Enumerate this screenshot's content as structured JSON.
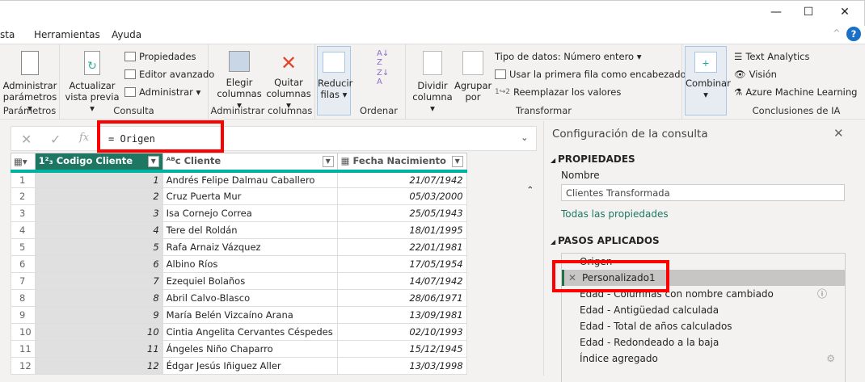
{
  "window": {
    "minimize": "—",
    "maximize": "☐",
    "close": "✕"
  },
  "menu_tabs": [
    "sta",
    "Herramientas",
    "Ayuda"
  ],
  "ribbon": {
    "groups": {
      "parametros": "Parámetros",
      "consulta": "Consulta",
      "admin_cols": "Administrar columnas",
      "ordenar": "Ordenar",
      "transformar": "Transformar",
      "ia": "Conclusiones de IA"
    },
    "admin_params": [
      "Administrar",
      "parámetros ▾"
    ],
    "actualizar": [
      "Actualizar",
      "vista previa ▾"
    ],
    "propiedades": "Propiedades",
    "editor": "Editor avanzado",
    "administrar": "Administrar ▾",
    "elegir": [
      "Elegir",
      "columnas ▾"
    ],
    "quitar": [
      "Quitar",
      "columnas ▾"
    ],
    "reducir": [
      "Reducir",
      "filas ▾"
    ],
    "dividir": [
      "Dividir",
      "columna ▾"
    ],
    "agrupar": [
      "Agrupar",
      "por"
    ],
    "tipo": "Tipo de datos: Número entero ▾",
    "primera_fila": "Usar la primera fila como encabezado ▾",
    "reemplazar": "Reemplazar los valores",
    "combinar": [
      "Combinar",
      "▾"
    ],
    "text_analytics": "Text Analytics",
    "vision": "Visión",
    "azure": "Azure Machine Learning"
  },
  "formula": {
    "text": "= Origen"
  },
  "table": {
    "columns": [
      "Codigo Cliente",
      "Cliente",
      "Fecha Nacimiento"
    ],
    "type_icons": [
      "1²₃",
      "ᴬᴮc",
      "▦"
    ],
    "rows": [
      [
        "1",
        "1",
        "Andrés Felipe Dalmau Caballero",
        "21/07/1942"
      ],
      [
        "2",
        "2",
        "Cruz Puerta Mur",
        "05/03/2000"
      ],
      [
        "3",
        "3",
        "Isa Cornejo Correa",
        "25/05/1943"
      ],
      [
        "4",
        "4",
        "Tere del Roldán",
        "18/01/1995"
      ],
      [
        "5",
        "5",
        "Rafa Arnaiz Vázquez",
        "22/01/1981"
      ],
      [
        "6",
        "6",
        "Albino Ríos",
        "17/05/1954"
      ],
      [
        "7",
        "7",
        "Ezequiel Bolaños",
        "14/07/1942"
      ],
      [
        "8",
        "8",
        "Abril Calvo-Blasco",
        "28/06/1971"
      ],
      [
        "9",
        "9",
        "María Belén Vizcaíno Arana",
        "13/09/1981"
      ],
      [
        "10",
        "10",
        "Cintia Angelita Cervantes Céspedes",
        "02/10/1993"
      ],
      [
        "11",
        "11",
        "Ángeles Niño Chaparro",
        "15/12/1945"
      ],
      [
        "12",
        "12",
        "Édgar Jesús Iñiguez Aller",
        "13/03/1998"
      ]
    ]
  },
  "panel": {
    "title": "Configuración de la consulta",
    "properties_header": "PROPIEDADES",
    "name_label": "Nombre",
    "name_value": "Clientes Transformada",
    "all_props": "Todas las propiedades",
    "steps_header": "PASOS APLICADOS",
    "steps": [
      "Origen",
      "Personalizado1",
      "Edad - Columnas con nombre cambiado",
      "Edad - Antigüedad calculada",
      "Edad - Total de años calculados",
      "Edad - Redondeado a la baja",
      "Índice agregado"
    ],
    "active_step": "Personalizado1"
  },
  "colors": {
    "accent": "#1e7763",
    "highlight": "#ff0000",
    "teal": "#00b2a0"
  }
}
